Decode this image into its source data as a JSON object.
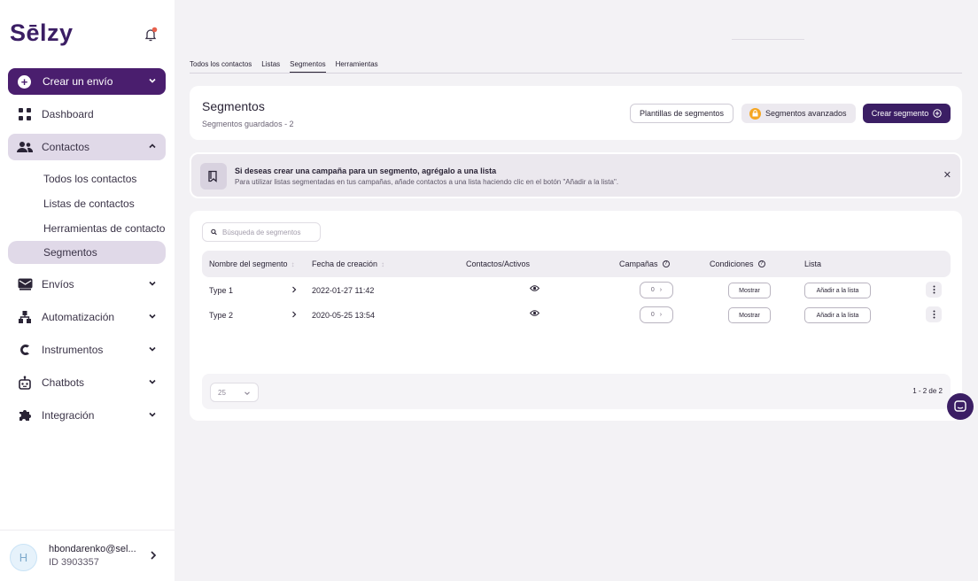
{
  "brand": {
    "logo": "Sēlzy"
  },
  "sidebar": {
    "create": "Crear un envío",
    "items": [
      {
        "label": "Dashboard",
        "icon": "grid-icon"
      },
      {
        "label": "Contactos",
        "icon": "users-icon"
      },
      {
        "label": "Envíos",
        "icon": "mail-icon"
      },
      {
        "label": "Automatización",
        "icon": "automation-icon"
      },
      {
        "label": "Instrumentos",
        "icon": "tools-icon"
      },
      {
        "label": "Chatbots",
        "icon": "bot-icon"
      },
      {
        "label": "Integración",
        "icon": "puzzle-icon"
      }
    ],
    "contacts_sub": [
      "Todos los contactos",
      "Listas de contactos",
      "Herramientas de contacto",
      "Segmentos"
    ]
  },
  "user": {
    "initial": "H",
    "email": "hbondarenko@sel...",
    "id": "ID 3903357"
  },
  "tabs": [
    "Todos los contactos",
    "Listas",
    "Segmentos",
    "Herramientas"
  ],
  "header": {
    "title": "Segmentos",
    "subtitle": "Segmentos guardados - 2",
    "templates_btn": "Plantillas de segmentos",
    "advanced_btn": "Segmentos avanzados",
    "create_btn": "Crear segmento"
  },
  "alert": {
    "title": "Si deseas crear una campaña para un segmento, agrégalo a una lista",
    "text": "Para utilizar listas segmentadas en tus campañas, añade contactos a una lista haciendo clic en el botón \"Añadir a la lista\"."
  },
  "table": {
    "search_placeholder": "Búsqueda de segmentos",
    "columns": [
      "Nombre del segmento",
      "Fecha de creación",
      "Contactos/Activos",
      "Campañas",
      "Condiciones",
      "Lista"
    ],
    "rows": [
      {
        "name": "Type 1",
        "date": "2022-01-27 11:42",
        "campaigns": "0",
        "show": "Mostrar",
        "add": "Añadir a la lista"
      },
      {
        "name": "Type 2",
        "date": "2020-05-25 13:54",
        "campaigns": "0",
        "show": "Mostrar",
        "add": "Añadir a la lista"
      }
    ],
    "per_page": "25",
    "pagination": "1 - 2 de 2"
  },
  "colors": {
    "brand": "#3b1e64",
    "active_bg": "#e0d9e8",
    "accent": "#f5a623"
  }
}
